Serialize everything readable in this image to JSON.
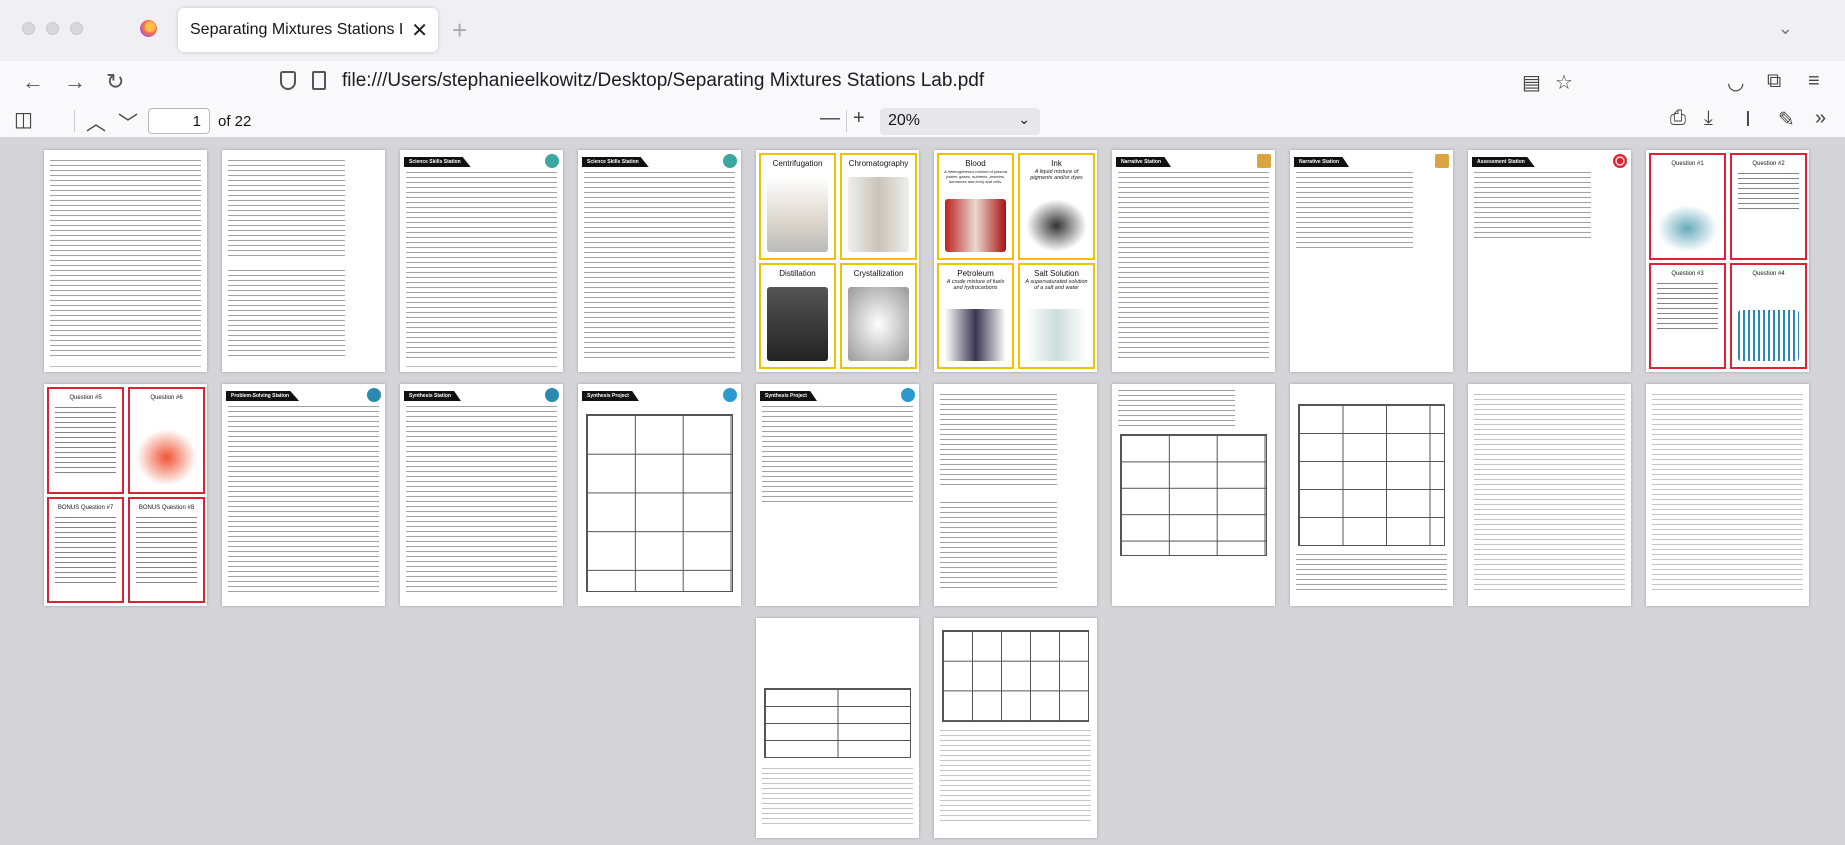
{
  "browser": {
    "tab_title": "Separating Mixtures Stations Lab.pdf",
    "tab_close": "✕",
    "new_tab": "+",
    "url": "file:///Users/stephanieelkowitz/Desktop/Separating Mixtures Stations Lab.pdf"
  },
  "pdf_toolbar": {
    "current_page": "1",
    "page_count": "of 22",
    "zoom": "20%"
  },
  "pages": {
    "p3_header": "Science Skills Station",
    "p4_header": "Science Skills Station",
    "p7_header": "Narrative Station",
    "p8_header": "Narrative Station",
    "p9_header": "Assessment Station",
    "p13_header": "Problem-Solving Station",
    "p14_header": "Synthesis Station",
    "p15_header": "Synthesis Project",
    "p16_header": "Synthesis Project"
  },
  "cards": {
    "centrifugation": "Centrifugation",
    "chromatography": "Chromatography",
    "distillation": "Distillation",
    "crystallization": "Crystallization",
    "blood": "Blood",
    "blood_sub": "A heterogeneous mixture of plasma (water, gases, nutrients, proteins, hormones and ions) and cells.",
    "ink": "Ink",
    "ink_sub": "A liquid mixture of pigments and/or dyes",
    "petroleum": "Petroleum",
    "petroleum_sub": "A crude mixture of fuels and hydrocarbons",
    "salt_solution": "Salt Solution",
    "salt_solution_sub": "A supersaturated solution of a salt and water",
    "q1": "Question #1",
    "q2": "Question #2",
    "q3": "Question #3",
    "q4": "Question #4",
    "q5": "Question #5",
    "q6": "Question #6",
    "bonus1": "BONUS Question #7",
    "bonus2": "BONUS Question #8"
  },
  "colors": {
    "yellow_card_border": "#f2c200",
    "red_card_border": "#d23"
  },
  "icons": [
    "firefox-logo",
    "back-arrow-icon",
    "forward-arrow-icon",
    "reload-icon",
    "shield-icon",
    "document-icon",
    "reader-view-icon",
    "bookmark-star-icon",
    "pocket-icon",
    "extensions-icon",
    "menu-icon",
    "sidebar-toggle-icon",
    "page-up-icon",
    "page-down-icon",
    "zoom-out-icon",
    "zoom-in-icon",
    "print-icon",
    "download-icon",
    "text-cursor-icon",
    "draw-icon",
    "more-tools-icon"
  ]
}
